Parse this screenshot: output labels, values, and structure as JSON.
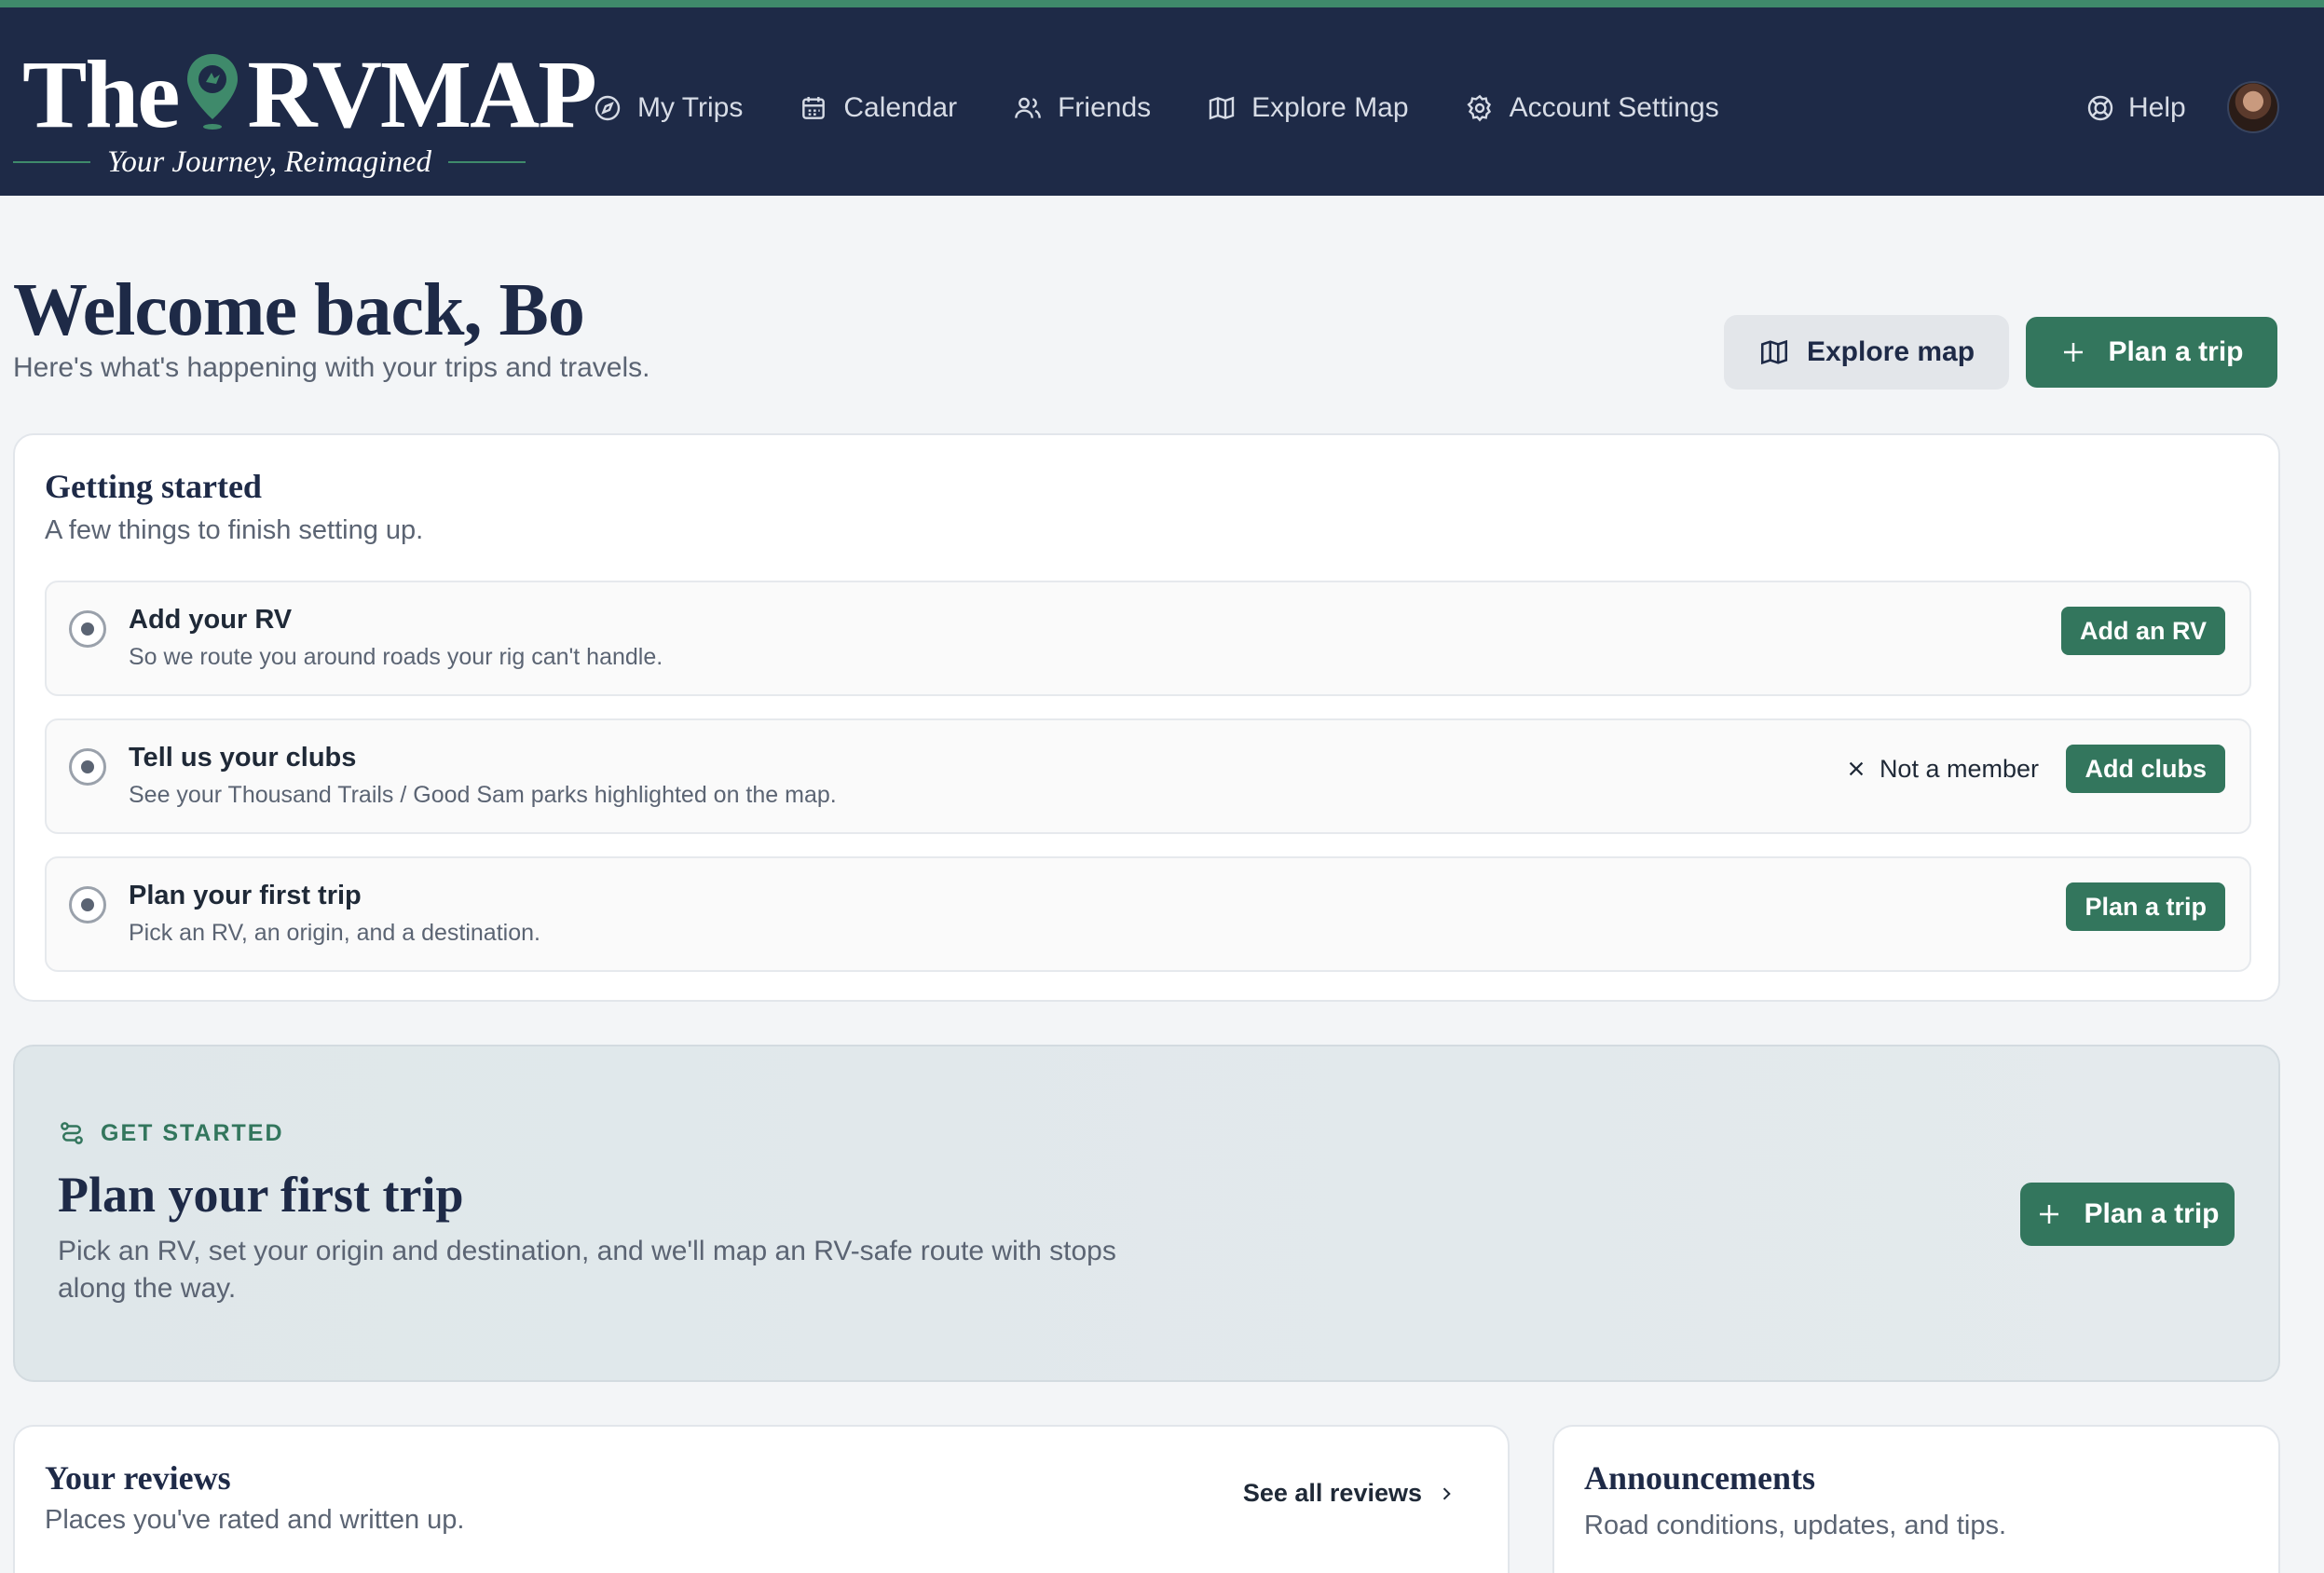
{
  "header": {
    "logo_left": "The",
    "logo_right": "RVMAP",
    "tagline": "Your Journey, Reimagined",
    "nav": [
      {
        "label": "My Trips",
        "icon": "compass-icon"
      },
      {
        "label": "Calendar",
        "icon": "calendar-icon"
      },
      {
        "label": "Friends",
        "icon": "users-icon"
      },
      {
        "label": "Explore Map",
        "icon": "map-icon"
      },
      {
        "label": "Account Settings",
        "icon": "gear-icon"
      }
    ],
    "help_label": "Help"
  },
  "welcome": {
    "title": "Welcome back, Bo",
    "subtitle": "Here's what's happening with your trips and travels.",
    "explore_label": "Explore map",
    "plan_label": "Plan a trip"
  },
  "getting_started": {
    "title": "Getting started",
    "subtitle": "A few things to finish setting up.",
    "items": [
      {
        "title": "Add your RV",
        "desc": "So we route you around roads your rig can't handle.",
        "button": "Add an RV"
      },
      {
        "title": "Tell us your clubs",
        "desc": "See your Thousand Trails / Good Sam parks highlighted on the map.",
        "secondary": "Not a member",
        "button": "Add clubs"
      },
      {
        "title": "Plan your first trip",
        "desc": "Pick an RV, an origin, and a destination.",
        "button": "Plan a trip"
      }
    ]
  },
  "hero": {
    "kicker": "GET STARTED",
    "title": "Plan your first trip",
    "desc": "Pick an RV, set your origin and destination, and we'll map an RV-safe route with stops along the way.",
    "button": "Plan a trip"
  },
  "reviews": {
    "title": "Your reviews",
    "subtitle": "Places you've rated and written up.",
    "link": "See all reviews"
  },
  "announcements": {
    "title": "Announcements",
    "subtitle": "Road conditions, updates, and tips."
  },
  "colors": {
    "navy": "#1e2a47",
    "green": "#33765d",
    "accent": "#3f8a6b"
  }
}
